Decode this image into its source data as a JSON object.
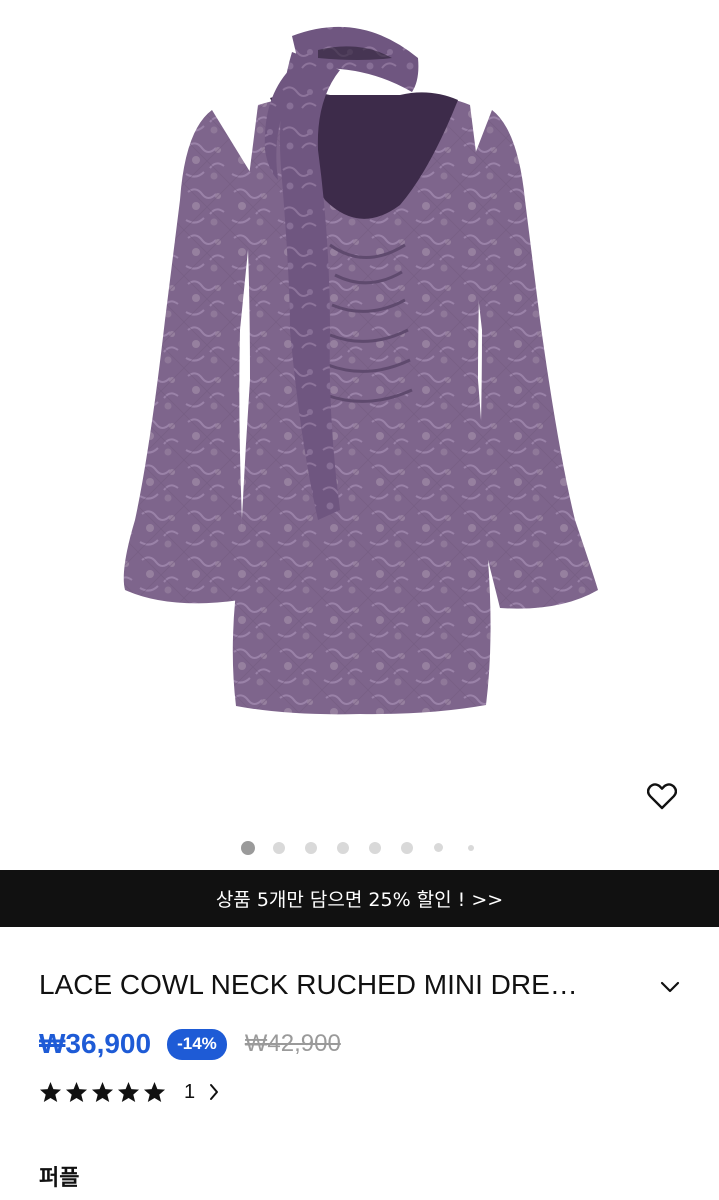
{
  "gallery": {
    "image_description_icon": "dress-image",
    "current_slide": 1,
    "total_slides": 8
  },
  "banner": {
    "text": "상품 5개만 담으면 25% 할인 ! >>"
  },
  "product": {
    "title": "LACE COWL NECK RUCHED MINI DRE…",
    "sale_price": "₩36,900",
    "discount": "-14%",
    "original_price": "₩42,900",
    "rating_stars": 5,
    "review_count": "1",
    "brand": "퍼플"
  },
  "colors": {
    "accent": "#1e5bd6",
    "banner_bg": "#111111",
    "dress": "#7b6189"
  },
  "icons": [
    "heart-icon",
    "chevron-down-icon",
    "star-icon",
    "chevron-right-icon"
  ]
}
